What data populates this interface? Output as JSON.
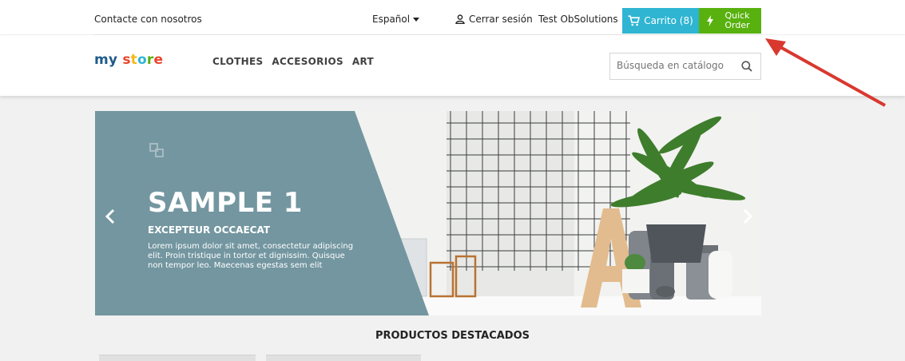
{
  "topnav": {
    "contact": "Contacte con nosotros",
    "language": "Español",
    "logout": "Cerrar sesión",
    "user": "Test ObSolutions",
    "cart": "Carrito (8)",
    "quick_order": "Quick\nOrder"
  },
  "header": {
    "logo_my": "my",
    "logo_store": [
      "s",
      "t",
      "o",
      "r",
      "e"
    ],
    "menu": [
      "CLOTHES",
      "ACCESORIOS",
      "ART"
    ],
    "search_placeholder": "Búsqueda en catálogo"
  },
  "slider": {
    "title": "SAMPLE 1",
    "subtitle": "EXCEPTEUR OCCAECAT",
    "text": "Lorem ipsum dolor sit amet, consectetur adipiscing elit. Proin tristique in tortor et dignissim. Quisque non tempor leo. Maecenas egestas sem elit"
  },
  "section": {
    "title": "PRODUCTOS DESTACADOS"
  },
  "colors": {
    "cart": "#2fb5d2",
    "quick_order": "#58b10e",
    "slide_panel": "#7396a0",
    "arrow_annotation": "#d9382f"
  }
}
